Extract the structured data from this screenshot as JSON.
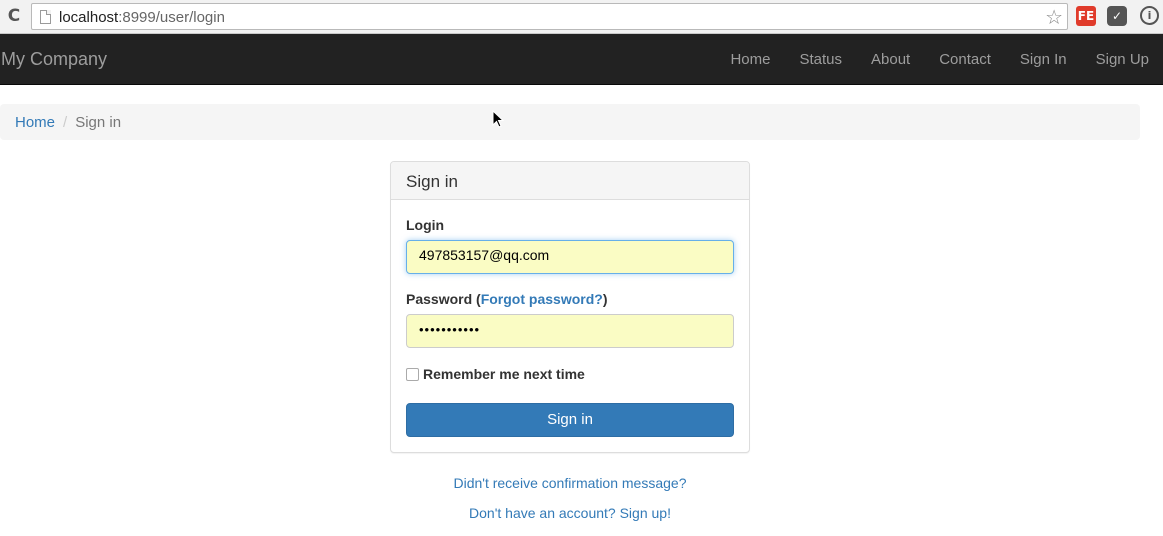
{
  "browser": {
    "url_host": "localhost",
    "url_path": ":8999/user/login",
    "reload_icon": "reload-icon",
    "bookmark_icon": "star-icon",
    "extensions": [
      "FE",
      "pocket",
      "i"
    ]
  },
  "navbar": {
    "brand": "My Company",
    "items": [
      "Home",
      "Status",
      "About",
      "Contact",
      "Sign In",
      "Sign Up"
    ],
    "background_color": "#222222"
  },
  "breadcrumb": {
    "home": "Home",
    "separator": "/",
    "current": "Sign in"
  },
  "panel": {
    "title": "Sign in",
    "login_label": "Login",
    "login_value": "497853157@qq.com",
    "password_label_prefix": "Password (",
    "forgot_link": "Forgot password?",
    "password_label_suffix": ")",
    "password_value": "•••••••••••",
    "remember_label": "Remember me next time",
    "submit_label": "Sign in",
    "accent_color": "#337ab7"
  },
  "links": {
    "resend": "Didn't receive confirmation message?",
    "signup": "Don't have an account? Sign up!"
  }
}
